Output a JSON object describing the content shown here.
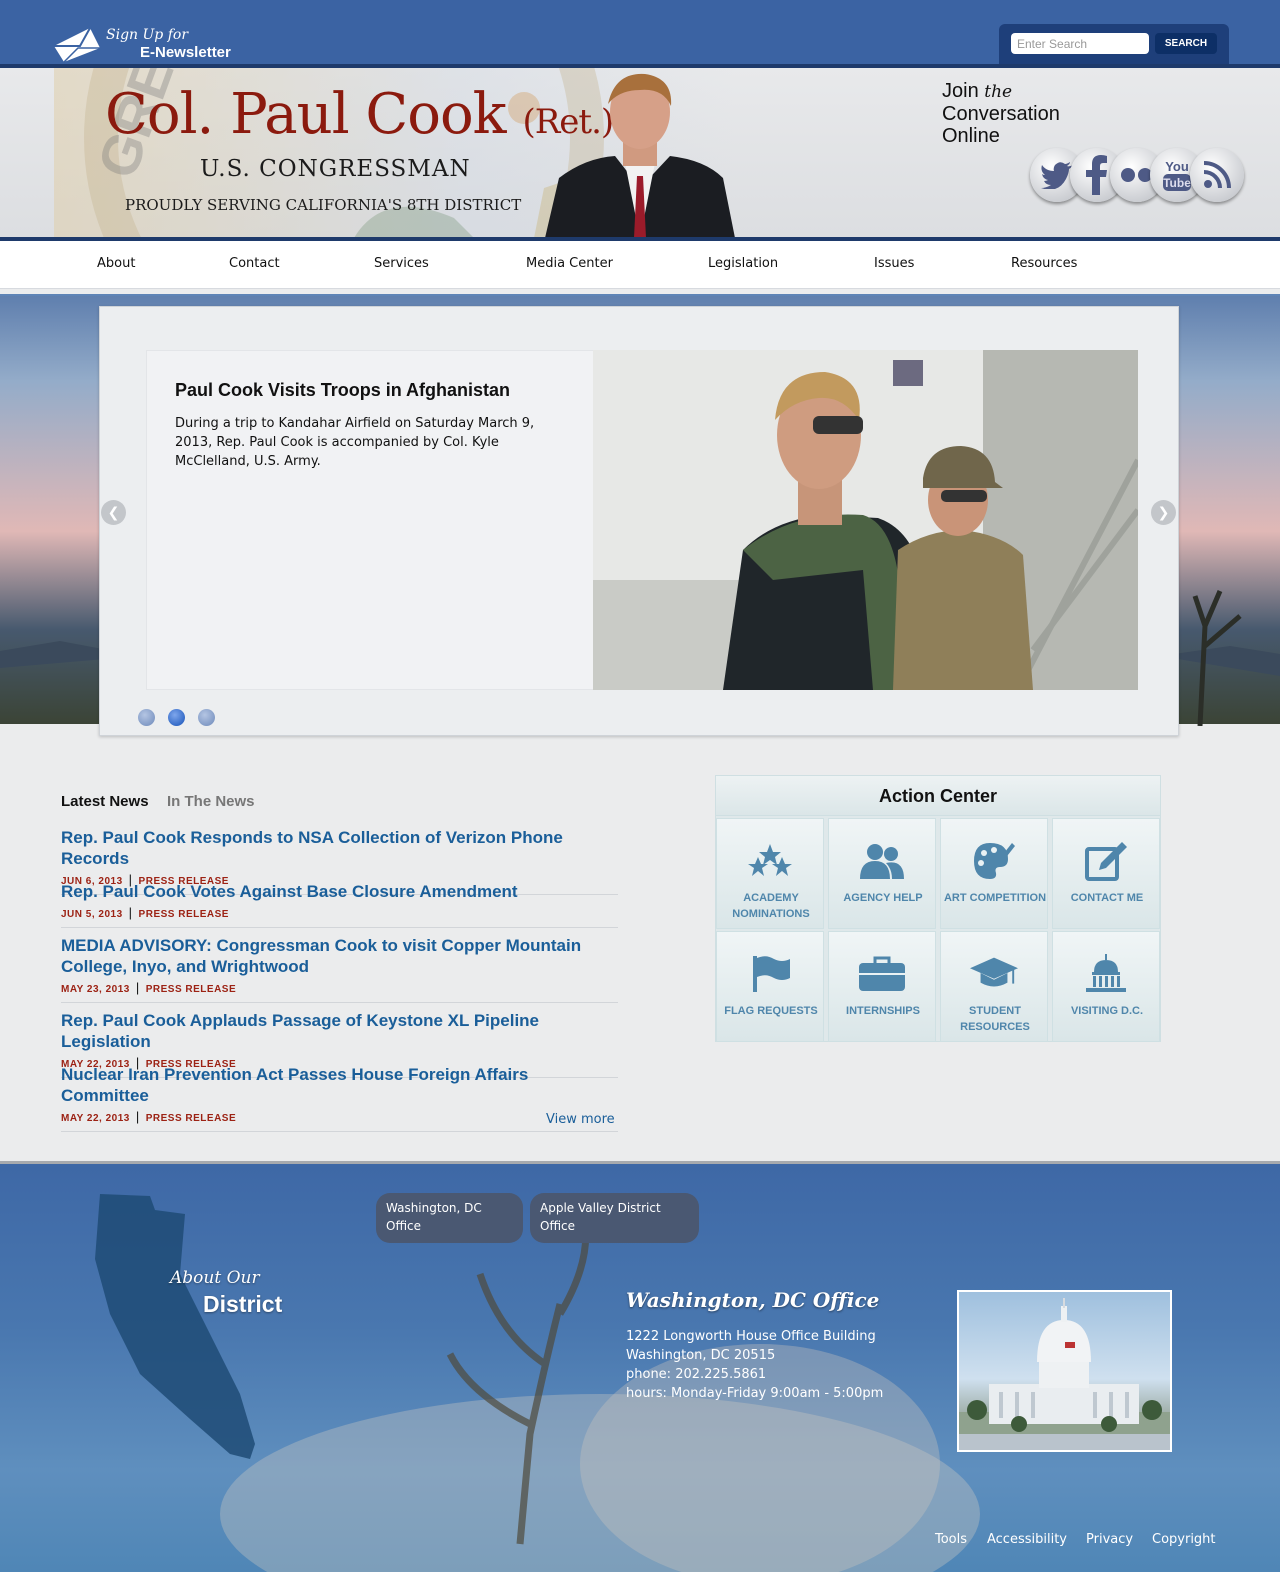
{
  "header": {
    "newsletter_line1": "Sign Up for",
    "newsletter_line2": "E-Newsletter",
    "search_placeholder": "Enter Search",
    "search_button": "SEARCH",
    "name": "Col. Paul Cook",
    "name_suffix": "(Ret.)",
    "subtitle": "U.S. CONGRESSMAN",
    "tagline": "PROUDLY SERVING CALIFORNIA'S 8TH DISTRICT",
    "join_word": "Join",
    "join_the": "the",
    "join_line2": "Conversation",
    "join_line3": "Online",
    "seal_text": "GREAT",
    "social": [
      "twitter-icon",
      "facebook-icon",
      "flickr-icon",
      "youtube-icon",
      "rss-icon"
    ]
  },
  "nav": [
    "About",
    "Contact",
    "Services",
    "Media Center",
    "Legislation",
    "Issues",
    "Resources"
  ],
  "slider": {
    "title": "Paul Cook Visits Troops in Afghanistan",
    "body": "During a trip to Kandahar Airfield on Saturday March 9, 2013, Rep. Paul Cook is accompanied by Col. Kyle McClelland, U.S. Army.",
    "active_slide": 2,
    "slide_count": 3
  },
  "news": {
    "tabs": [
      "Latest News",
      "In The News"
    ],
    "items": [
      {
        "title": "Rep. Paul Cook Responds to NSA Collection of Verizon Phone Records",
        "date": "JUN 6, 2013",
        "type": "PRESS RELEASE"
      },
      {
        "title": "Rep. Paul Cook Votes Against Base Closure Amendment",
        "date": "JUN 5, 2013",
        "type": "PRESS RELEASE"
      },
      {
        "title": "MEDIA ADVISORY: Congressman Cook to visit Copper Mountain College, Inyo, and Wrightwood",
        "date": "MAY 23, 2013",
        "type": "PRESS RELEASE"
      },
      {
        "title": "Rep. Paul Cook Applauds Passage of Keystone XL Pipeline Legislation",
        "date": "MAY 22, 2013",
        "type": "PRESS RELEASE"
      },
      {
        "title": "Nuclear Iran Prevention Act Passes House Foreign Affairs Committee",
        "date": "MAY 22, 2013",
        "type": "PRESS RELEASE"
      }
    ],
    "view_more": "View more"
  },
  "action_center": {
    "title": "Action Center",
    "tiles": [
      {
        "label": "ACADEMY NOMINATIONS",
        "icon": "stars-icon"
      },
      {
        "label": "AGENCY HELP",
        "icon": "people-icon"
      },
      {
        "label": "ART COMPETITION",
        "icon": "palette-icon"
      },
      {
        "label": "CONTACT ME",
        "icon": "edit-icon"
      },
      {
        "label": "FLAG REQUESTS",
        "icon": "flag-icon"
      },
      {
        "label": "INTERNSHIPS",
        "icon": "briefcase-icon"
      },
      {
        "label": "STUDENT RESOURCES",
        "icon": "graduation-cap-icon"
      },
      {
        "label": "VISITING D.C.",
        "icon": "capitol-icon"
      }
    ]
  },
  "footer": {
    "office_tabs": [
      "Washington, DC Office",
      "Apple Valley District Office"
    ],
    "about_line1": "About Our",
    "about_line2": "District",
    "office_heading": "Washington, DC Office",
    "address_lines": [
      "1222 Longworth House Office Building",
      "Washington, DC 20515",
      "phone: 202.225.5861",
      "hours: Monday-Friday 9:00am - 5:00pm"
    ],
    "links": [
      "Tools",
      "Accessibility",
      "Privacy",
      "Copyright"
    ]
  },
  "colors": {
    "brand_blue": "#3b63a3",
    "dark_blue": "#1e3a6b",
    "name_red": "#8b1a0e",
    "link_blue": "#1a5e99",
    "meta_red": "#9c2214",
    "tile_blue": "#4f86ab"
  }
}
